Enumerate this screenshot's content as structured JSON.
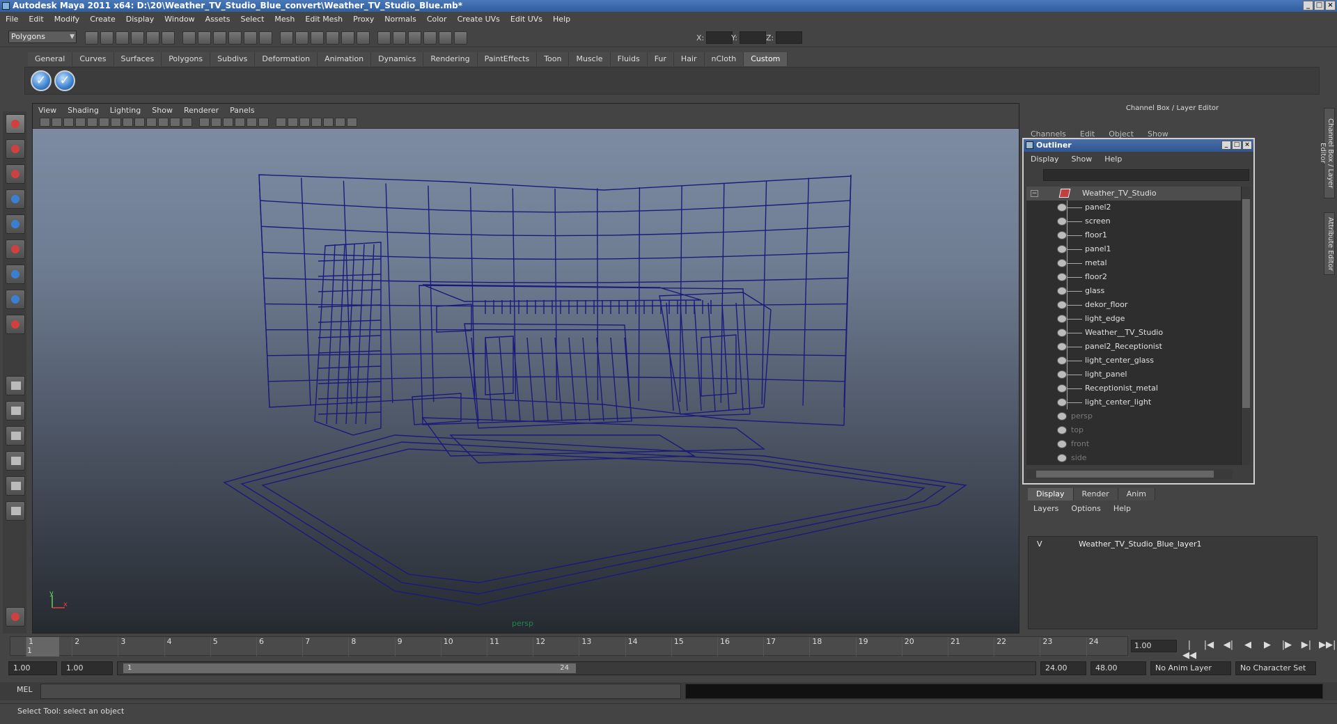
{
  "window": {
    "title": "Autodesk Maya 2011 x64: D:\\20\\Weather_TV_Studio_Blue_convert\\Weather_TV_Studio_Blue.mb*"
  },
  "menubar": [
    "File",
    "Edit",
    "Modify",
    "Create",
    "Display",
    "Window",
    "Assets",
    "Select",
    "Mesh",
    "Edit Mesh",
    "Proxy",
    "Normals",
    "Color",
    "Create UVs",
    "Edit UVs",
    "Help"
  ],
  "statusline": {
    "mode": "Polygons",
    "x_label": "X:",
    "y_label": "Y:",
    "z_label": "Z:"
  },
  "shelf": {
    "tabs": [
      "General",
      "Curves",
      "Surfaces",
      "Polygons",
      "Subdivs",
      "Deformation",
      "Animation",
      "Dynamics",
      "Rendering",
      "PaintEffects",
      "Toon",
      "Muscle",
      "Fluids",
      "Fur",
      "Hair",
      "nCloth",
      "Custom"
    ],
    "active_tab": "Custom"
  },
  "viewport": {
    "menu": [
      "View",
      "Shading",
      "Lighting",
      "Show",
      "Renderer",
      "Panels"
    ],
    "camera": "persp",
    "axis_x": "x",
    "axis_y": "y",
    "wire_color": "#1a1a7a"
  },
  "channelbox": {
    "title": "Channel Box / Layer Editor",
    "menu": [
      "Channels",
      "Edit",
      "Object",
      "Show"
    ]
  },
  "sidetabs": [
    "Channel Box / Layer Editor",
    "Attribute Editor"
  ],
  "outliner": {
    "title": "Outliner",
    "menu": [
      "Display",
      "Show",
      "Help"
    ],
    "root": "Weather_TV_Studio",
    "items": [
      "panel2",
      "screen",
      "floor1",
      "panel1",
      "metal",
      "floor2",
      "glass",
      "dekor_floor",
      "light_edge",
      "Weather__TV_Studio",
      "panel2_Receptionist",
      "light_center_glass",
      "light_panel",
      "Receptionist_metal",
      "light_center_light"
    ],
    "cameras": [
      "persp",
      "top",
      "front",
      "side"
    ]
  },
  "layers": {
    "tabs": [
      "Display",
      "Render",
      "Anim"
    ],
    "active_tab": "Display",
    "menu": [
      "Layers",
      "Options",
      "Help"
    ],
    "rows": [
      {
        "visible": "V",
        "name": "Weather_TV_Studio_Blue_layer1"
      }
    ]
  },
  "timeline": {
    "ticks": [
      "1",
      "2",
      "3",
      "4",
      "5",
      "6",
      "7",
      "8",
      "9",
      "10",
      "11",
      "12",
      "13",
      "14",
      "15",
      "16",
      "17",
      "18",
      "19",
      "20",
      "21",
      "22",
      "23",
      "24"
    ],
    "current": "1",
    "current_frame": "1.00"
  },
  "range": {
    "start": "1.00",
    "start2": "1.00",
    "thumb_start": "1",
    "thumb_end": "24",
    "end": "24.00",
    "end2": "48.00",
    "anim_layer": "No Anim Layer",
    "char_set": "No Character Set"
  },
  "cmdline": {
    "label": "MEL"
  },
  "helpline": {
    "text": "Select Tool: select an object"
  },
  "playback": [
    "|◀◀",
    "|◀",
    "◀|",
    "◀",
    "▶",
    "|▶",
    "▶|",
    "▶▶|"
  ]
}
